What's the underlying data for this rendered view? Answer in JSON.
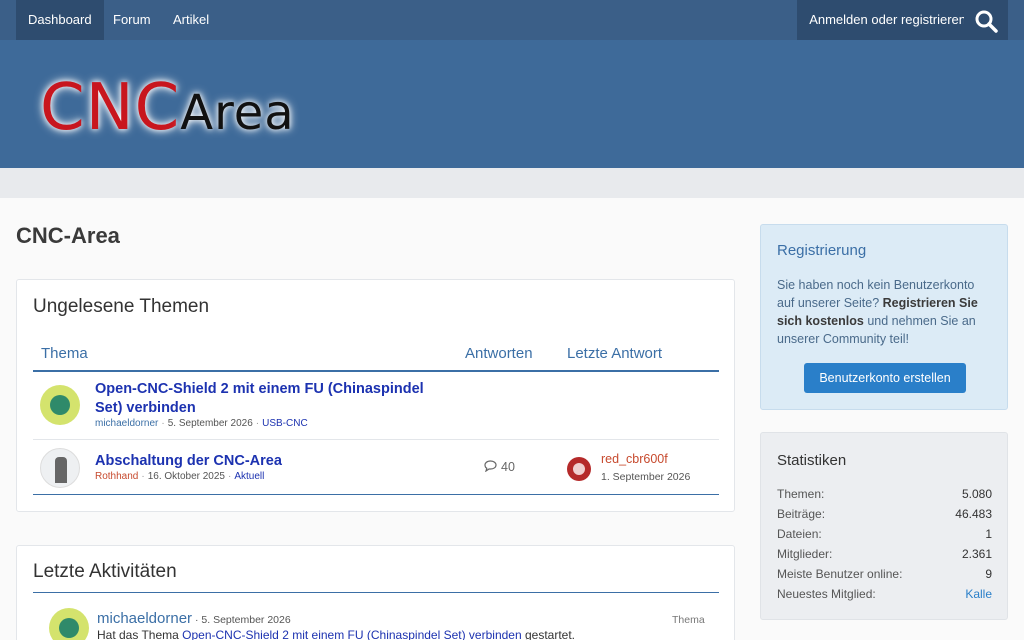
{
  "nav": {
    "items": [
      {
        "label": "Dashboard"
      },
      {
        "label": "Forum"
      },
      {
        "label": "Artikel"
      }
    ],
    "login_label": "Anmelden oder registrieren",
    "search_icon": "search-icon"
  },
  "header": {
    "logo_part1": "CNC",
    "logo_part2": "Area"
  },
  "page": {
    "title": "CNC-Area"
  },
  "unread": {
    "title": "Ungelesene Themen",
    "columns": {
      "topic": "Thema",
      "replies": "Antworten",
      "last": "Letzte Antwort"
    },
    "rows": [
      {
        "title": "Open-CNC-Shield 2 mit einem FU (Chinaspindel Set) verbinden",
        "author": "michaeldorner",
        "date": "5. September 2026",
        "tag": "USB-CNC"
      },
      {
        "title": "Abschaltung der CNC-Area",
        "author": "Rothhand",
        "date": "16. Oktober 2025",
        "tag": "Aktuell",
        "replies": "40",
        "last_user": "red_cbr600f",
        "last_date": "1. September 2026"
      }
    ]
  },
  "activity": {
    "title": "Letzte Aktivitäten",
    "item": {
      "user": "michaeldorner",
      "date": "5. September 2026",
      "type": "Thema",
      "text_prefix": "Hat das Thema ",
      "link": "Open-CNC-Shield 2 mit einem FU (Chinaspindel Set) verbinden",
      "text_suffix": " gestartet."
    }
  },
  "sidebar": {
    "registration": {
      "title": "Registrierung",
      "text1": "Sie haben noch kein Benutzerkonto auf unserer Seite? ",
      "text_bold": "Registrieren Sie sich kostenlos",
      "text2": " und nehmen Sie an unserer Community teil!",
      "button": "Benutzerkonto erstellen"
    },
    "stats": {
      "title": "Statistiken",
      "items": [
        {
          "label": "Themen:",
          "value": "5.080"
        },
        {
          "label": "Beiträge:",
          "value": "46.483"
        },
        {
          "label": "Dateien:",
          "value": "1"
        },
        {
          "label": "Mitglieder:",
          "value": "2.361"
        },
        {
          "label": "Meiste Benutzer online:",
          "value": "9"
        },
        {
          "label": "Neuestes Mitglied:",
          "value": "Kalle"
        }
      ]
    }
  },
  "colors": {
    "nav": "#3b5f88",
    "header": "#3e6a99",
    "link": "#1c32b0",
    "accent": "#2a7fc9"
  }
}
